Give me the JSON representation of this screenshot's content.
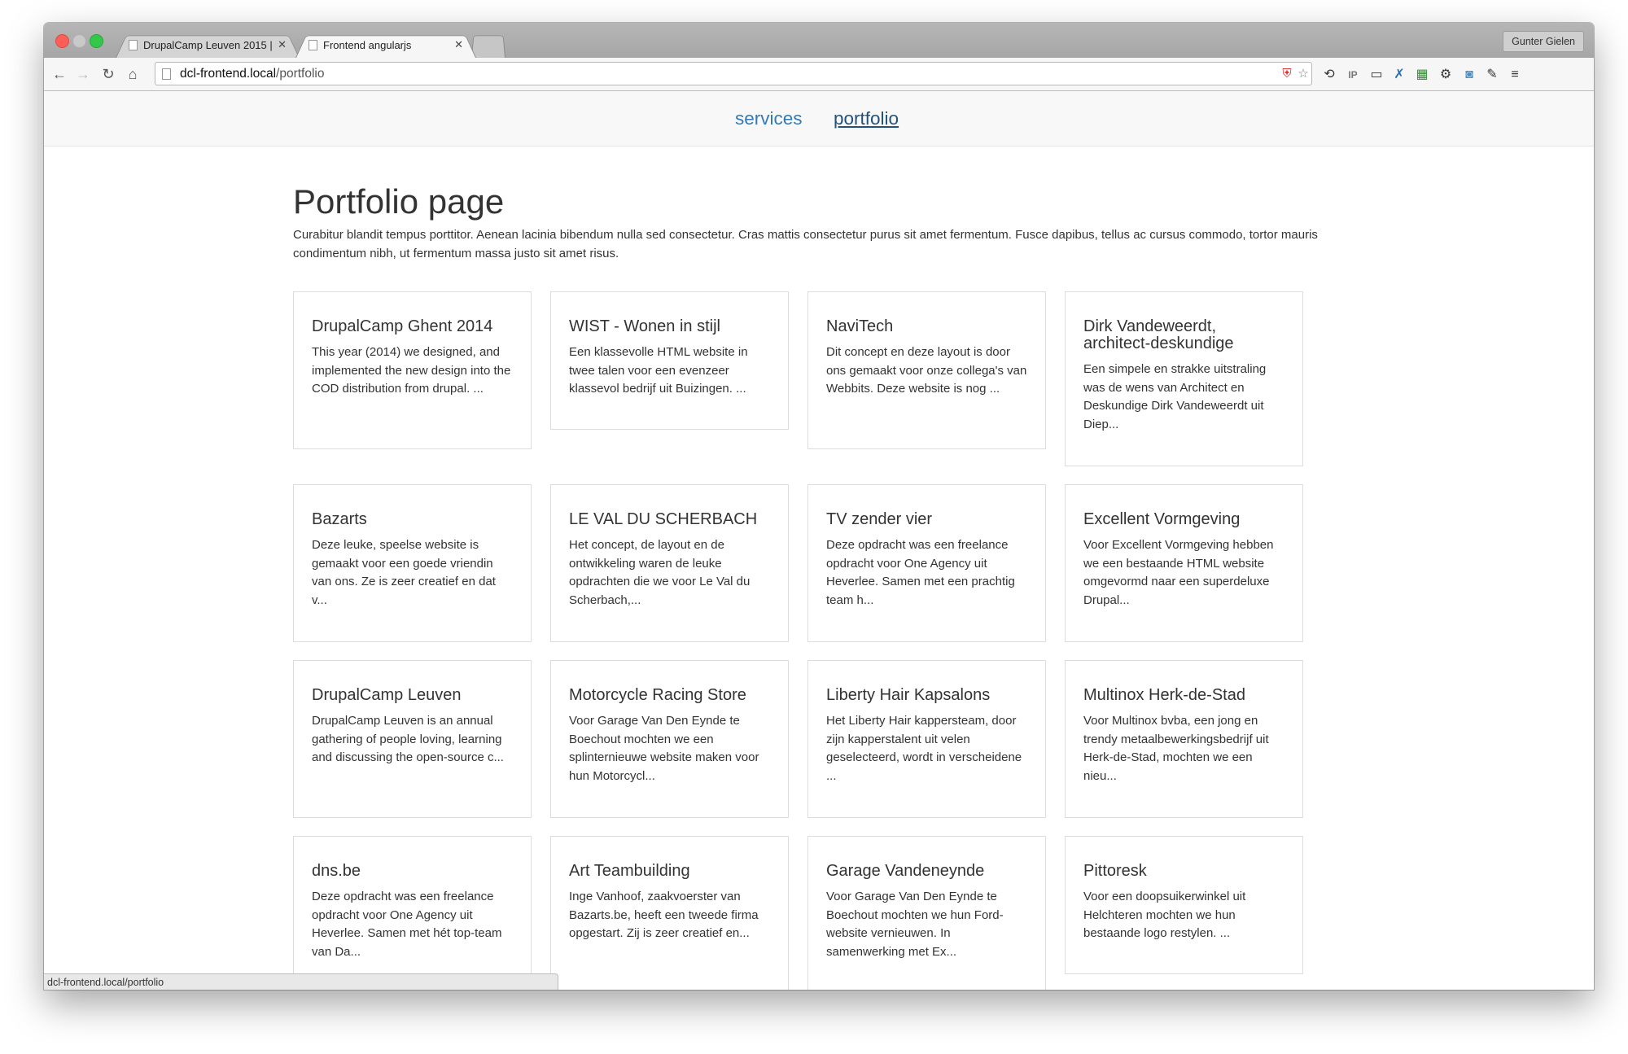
{
  "browser": {
    "tabs": [
      {
        "title": "DrupalCamp Leuven 2015 |",
        "active": false
      },
      {
        "title": "Frontend angularjs",
        "active": true
      }
    ],
    "user": "Gunter Gielen",
    "url_host": "dcl-frontend.local",
    "url_path": "/portfolio",
    "status_url": "dcl-frontend.local/portfolio"
  },
  "nav": {
    "items": [
      {
        "label": "services"
      },
      {
        "label": "portfolio"
      }
    ]
  },
  "page": {
    "title": "Portfolio page",
    "intro": "Curabitur blandit tempus porttitor. Aenean lacinia bibendum nulla sed consectetur. Cras mattis consectetur purus sit amet fermentum. Fusce dapibus, tellus ac cursus commodo, tortor mauris condimentum nibh, ut fermentum massa justo sit amet risus."
  },
  "cards": [
    {
      "title": "DrupalCamp Ghent 2014",
      "text": "This year (2014) we designed, and implemented the new design into the COD distribution from drupal. ..."
    },
    {
      "title": "WIST - Wonen in stijl",
      "text": "Een klassevolle HTML website in twee talen voor een evenzeer klassevol bedrijf uit Buizingen. ..."
    },
    {
      "title": "NaviTech",
      "text": "Dit concept en deze layout is door ons gemaakt voor onze collega's van Webbits. Deze website is nog ..."
    },
    {
      "title": "Dirk Vandeweerdt, architect-deskundige",
      "text": "Een simpele en strakke uitstraling was de wens van Architect en Deskundige Dirk Vandeweerdt uit Diep..."
    },
    {
      "title": "Bazarts",
      "text": "Deze leuke, speelse website is gemaakt voor een goede vriendin van ons. Ze is zeer creatief en dat v..."
    },
    {
      "title": "LE VAL DU SCHERBACH",
      "text": "Het concept, de layout en de ontwikkeling waren de leuke opdrachten die we voor Le Val du Scherbach,..."
    },
    {
      "title": "TV zender vier",
      "text": "Deze opdracht was een freelance opdracht voor One Agency uit Heverlee. Samen met een prachtig team h..."
    },
    {
      "title": "Excellent Vormgeving",
      "text": "Voor Excellent Vormgeving hebben we een bestaande HTML website omgevormd naar een superdeluxe Drupal..."
    },
    {
      "title": "DrupalCamp Leuven",
      "text": "DrupalCamp Leuven is an annual gathering of people loving, learning and discussing the open-source c..."
    },
    {
      "title": "Motorcycle Racing Store",
      "text": "Voor Garage Van Den Eynde te Boechout mochten we een splinternieuwe website maken voor hun Motorcycl..."
    },
    {
      "title": "Liberty Hair Kapsalons",
      "text": "Het Liberty Hair kappersteam, door zijn kapperstalent uit velen geselecteerd, wordt in verscheidene ..."
    },
    {
      "title": "Multinox Herk-de-Stad",
      "text": "Voor Multinox bvba, een jong en trendy metaalbewerkingsbedrijf uit Herk-de-Stad, mochten we een nieu..."
    },
    {
      "title": "dns.be",
      "text": "Deze opdracht was een freelance opdracht voor One Agency uit Heverlee. Samen met hét top-team van Da..."
    },
    {
      "title": "Art Teambuilding",
      "text": "Inge Vanhoof, zaakvoerster van Bazarts.be, heeft een tweede firma opgestart. Zij is zeer creatief en..."
    },
    {
      "title": "Garage Vandeneynde",
      "text": "Voor Garage Van Den Eynde te Boechout mochten we hun Ford-website vernieuwen. In samenwerking met Ex..."
    },
    {
      "title": "Pittoresk",
      "text": "Voor een doopsuikerwinkel uit Helchteren mochten we hun bestaande logo restylen. ..."
    }
  ]
}
